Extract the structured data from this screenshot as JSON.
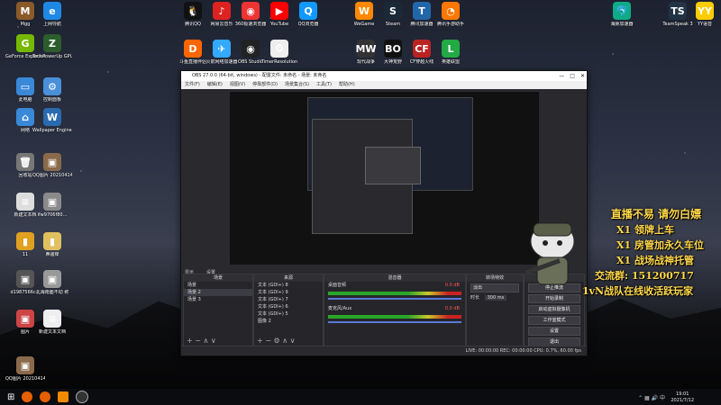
{
  "desktop": {
    "left_icons": [
      {
        "label": "Mgg",
        "color": "#8a5a2a",
        "glyph": "M"
      },
      {
        "label": "上网导航",
        "color": "#1e88e5",
        "glyph": "e"
      },
      {
        "label": "GeForce Experience",
        "color": "#76b900",
        "glyph": "G"
      },
      {
        "label": "TechPowerUp GPU-Z",
        "color": "#2c5d2c",
        "glyph": "Z"
      },
      {
        "label": "此电脑",
        "color": "#3a88d8",
        "glyph": "▭"
      },
      {
        "label": "控制面板",
        "color": "#4a90d9",
        "glyph": "⚙"
      },
      {
        "label": "网络",
        "color": "#3a88d8",
        "glyph": "⌂"
      },
      {
        "label": "Wallpaper Engine: ...",
        "color": "#2a6bb0",
        "glyph": "W"
      },
      {
        "label": "回收站",
        "color": "#777",
        "glyph": "🗑"
      },
      {
        "label": "QQ图片 20210414...",
        "color": "#8a6a4a",
        "glyph": "▣"
      },
      {
        "label": "新建文本档",
        "color": "#ddd",
        "glyph": "≡"
      },
      {
        "label": "ifw9706f80...",
        "color": "#8a8a8a",
        "glyph": "▣"
      },
      {
        "label": "11",
        "color": "#e0a020",
        "glyph": "▮"
      },
      {
        "label": "鼻骚痒",
        "color": "#e0c060",
        "glyph": "▮"
      },
      {
        "label": "d1987566c...",
        "color": "#555",
        "glyph": "▣"
      },
      {
        "label": "北海南面不动 称",
        "color": "#999",
        "glyph": "▣"
      },
      {
        "label": "图片",
        "color": "#c44",
        "glyph": "▣"
      },
      {
        "label": "新建文本文档",
        "color": "#eee",
        "glyph": "≡"
      },
      {
        "label": "QQ图片 20210414...",
        "color": "#8a6a4a",
        "glyph": "▣"
      }
    ],
    "top_icons": [
      {
        "label": "腾讯QQ",
        "color": "#111",
        "glyph": "🐧"
      },
      {
        "label": "网易云音乐",
        "color": "#d22",
        "glyph": "♪"
      },
      {
        "label": "360极速浏览器",
        "color": "#e33",
        "glyph": "◉"
      },
      {
        "label": "YouTube",
        "color": "#f00",
        "glyph": "▶"
      },
      {
        "label": "QQ浏览器",
        "color": "#19f",
        "glyph": "Q"
      },
      {
        "label": "WeGame",
        "color": "#f80",
        "glyph": "W"
      },
      {
        "label": "Steam",
        "color": "#1b2838",
        "glyph": "S"
      },
      {
        "label": "腾讯加速器",
        "color": "#26a",
        "glyph": "T"
      },
      {
        "label": "腾讯手游助手",
        "color": "#f70",
        "glyph": "◔"
      },
      {
        "label": "斗鱼直播伴侣",
        "color": "#f60",
        "glyph": "D"
      },
      {
        "label": "火箭网络加速器",
        "color": "#3af",
        "glyph": "✈"
      },
      {
        "label": "OBS Studio",
        "color": "#222",
        "glyph": "◉"
      },
      {
        "label": "TimerResolution",
        "color": "#eee",
        "glyph": "⏱"
      },
      {
        "label": "现代战争",
        "color": "#333",
        "glyph": "MW"
      },
      {
        "label": "大神荒野",
        "color": "#111",
        "glyph": "BO"
      },
      {
        "label": "CF穿越火线",
        "color": "#b22",
        "glyph": "CF"
      },
      {
        "label": "英雄联盟",
        "color": "#2a4",
        "glyph": "L"
      }
    ],
    "right_icons": [
      {
        "label": "海豚加速器",
        "color": "#1a8",
        "glyph": "🐬"
      },
      {
        "label": "TeamSpeak 3",
        "color": "#234",
        "glyph": "TS"
      },
      {
        "label": "YY语音",
        "color": "#fc0",
        "glyph": "YY"
      }
    ]
  },
  "obs": {
    "title": "OBS 27.0.0 (64-bit, windows) - 配置文件: 未命名 - 场景: 未命名",
    "window_buttons": [
      "—",
      "□",
      "✕"
    ],
    "menu": [
      "文件(F)",
      "编辑(E)",
      "视图(V)",
      "停靠部件(D)",
      "场景集合(S)",
      "工具(T)",
      "帮助(H)"
    ],
    "preview_toolbar": [
      "显示",
      "设置"
    ],
    "docks": {
      "scenes": {
        "title": "场景",
        "items": [
          "场景",
          "场景 2",
          "场景 3"
        ]
      },
      "sources": {
        "title": "来源",
        "items": [
          "文本 (GDI+) 8",
          "文本 (GDI+) 9",
          "文本 (GDI+) 7",
          "文本 (GDI+) 6",
          "文本 (GDI+) 5",
          "图像 2"
        ]
      },
      "mixer": {
        "title": "混音器",
        "channels": [
          {
            "name": "桌面音频",
            "db": "0.0 dB"
          },
          {
            "name": "麦克风/Aux",
            "db": "0.0 dB"
          }
        ]
      },
      "transitions": {
        "title": "转场特效",
        "type": "淡出",
        "duration_label": "时长",
        "duration": "300 ms"
      },
      "controls": {
        "title": "控件",
        "buttons": [
          "停止推流",
          "开始录制",
          "启动虚拟摄像机",
          "工作室模式",
          "设置",
          "退出"
        ]
      }
    },
    "status": "LIVE: 00:00:00  REC: 00:00:00  CPU: 0.7%, 60.00 fps"
  },
  "overlay": {
    "lines": [
      "直播不易 请勿白嫖",
      "X1 领牌上车",
      "X1 房管加永久车位",
      "X1 战场战神托管",
      "交流群: 151200717",
      "1vN战队在线收活跃玩家"
    ]
  },
  "taskbar": {
    "time": "19:01",
    "date": "2021/7/12"
  }
}
